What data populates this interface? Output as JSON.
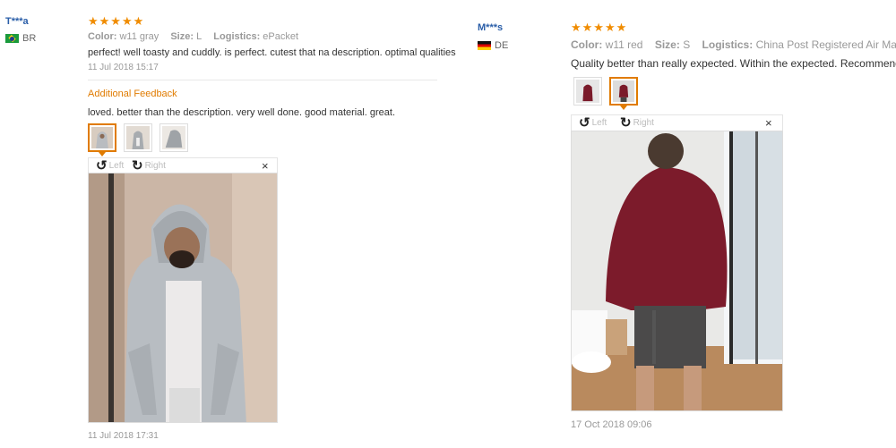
{
  "reviews": [
    {
      "user": "T***a",
      "country": "BR",
      "rating_stars": "★★★★★",
      "rating": 5,
      "attrs": {
        "color_label": "Color:",
        "color_value": "w11 gray",
        "size_label": "Size:",
        "size_value": "L",
        "logistics_label": "Logistics:",
        "logistics_value": "ePacket"
      },
      "text": "perfect! well toasty and cuddly. is perfect. cutest that na description. optimal qualities",
      "date": "11 Jul 2018 15:17",
      "additional": {
        "heading": "Additional Feedback",
        "text": "loved. better than the description. very well done. good material. great.",
        "date": "11 Jul 2018 17:31"
      },
      "viewer": {
        "left_label": "Left",
        "right_label": "Right",
        "close": "×"
      }
    },
    {
      "user": "M***s",
      "country": "DE",
      "rating_stars": "★★★★★",
      "rating": 5,
      "attrs": {
        "color_label": "Color:",
        "color_value": "w11 red",
        "size_label": "Size:",
        "size_value": "S",
        "logistics_label": "Logistics:",
        "logistics_value": "China Post Registered Air Mail"
      },
      "text": "Quality better than really expected. Within the expected. Recommend!",
      "date": "17 Oct 2018 09:06",
      "viewer": {
        "left_label": "Left",
        "right_label": "Right",
        "close": "×"
      }
    }
  ],
  "colors": {
    "star": "#f08c00",
    "accent": "#e07b00",
    "username": "#2a5ea8"
  }
}
